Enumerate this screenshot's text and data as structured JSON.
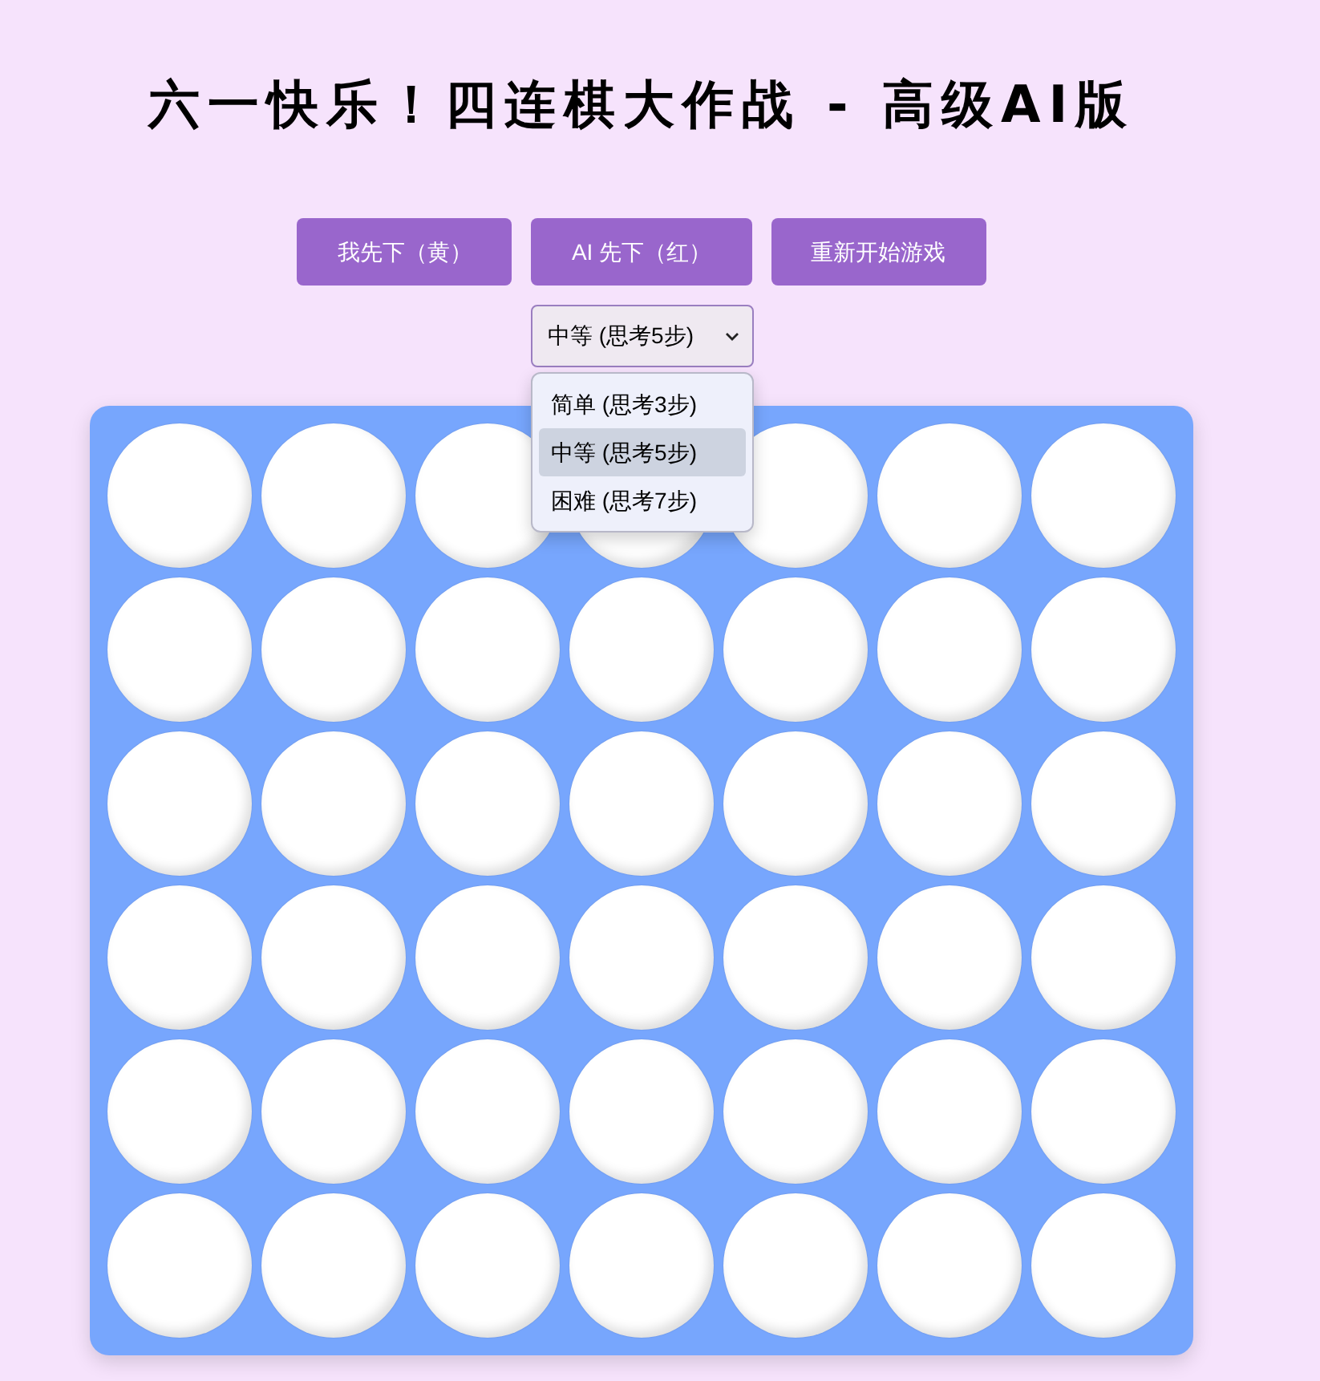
{
  "title": "六一快乐！四连棋大作战 - 高级AI版",
  "buttons": [
    {
      "label": "我先下（黄）"
    },
    {
      "label": "AI 先下（红）"
    },
    {
      "label": "重新开始游戏"
    }
  ],
  "difficulty": {
    "value": "中等 (思考5步)",
    "expanded": true,
    "options": [
      {
        "label": "简单 (思考3步)",
        "selected": false
      },
      {
        "label": "中等 (思考5步)",
        "selected": true
      },
      {
        "label": "困难 (思考7步)",
        "selected": false
      }
    ]
  },
  "board": {
    "rows": [
      {
        "cells": [
          {
            "kind": "empty"
          },
          {
            "kind": "empty"
          },
          {
            "kind": "empty"
          },
          {
            "kind": "empty"
          },
          {
            "kind": "empty"
          },
          {
            "kind": "empty"
          },
          {
            "kind": "empty"
          }
        ]
      },
      {
        "cells": [
          {
            "kind": "empty"
          },
          {
            "kind": "empty"
          },
          {
            "kind": "empty"
          },
          {
            "kind": "empty"
          },
          {
            "kind": "empty"
          },
          {
            "kind": "empty"
          },
          {
            "kind": "empty"
          }
        ]
      },
      {
        "cells": [
          {
            "kind": "empty"
          },
          {
            "kind": "empty"
          },
          {
            "kind": "empty"
          },
          {
            "kind": "empty"
          },
          {
            "kind": "empty"
          },
          {
            "kind": "empty"
          },
          {
            "kind": "empty"
          }
        ]
      },
      {
        "cells": [
          {
            "kind": "empty"
          },
          {
            "kind": "empty"
          },
          {
            "kind": "empty"
          },
          {
            "kind": "empty"
          },
          {
            "kind": "empty"
          },
          {
            "kind": "empty"
          },
          {
            "kind": "empty"
          }
        ]
      },
      {
        "cells": [
          {
            "kind": "empty"
          },
          {
            "kind": "empty"
          },
          {
            "kind": "empty"
          },
          {
            "kind": "empty"
          },
          {
            "kind": "empty"
          },
          {
            "kind": "empty"
          },
          {
            "kind": "empty"
          }
        ]
      },
      {
        "cells": [
          {
            "kind": "empty"
          },
          {
            "kind": "empty"
          },
          {
            "kind": "empty"
          },
          {
            "kind": "empty"
          },
          {
            "kind": "empty"
          },
          {
            "kind": "empty"
          },
          {
            "kind": "empty"
          }
        ]
      }
    ]
  }
}
